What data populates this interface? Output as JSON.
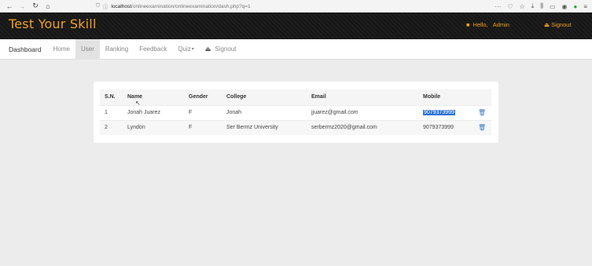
{
  "browser": {
    "url_prefix": "localhost",
    "url_rest": "/onlineexamination/onlineexamination/dash.php?q=1"
  },
  "header": {
    "brand": "Test Your Skill",
    "greeting": "Hello,",
    "user": "Admin",
    "signout": "Signout"
  },
  "nav": {
    "title": "Dashboard",
    "items": [
      "Home",
      "User",
      "Ranking",
      "Feedback",
      "Quiz"
    ],
    "active": "User",
    "signout": "Signout"
  },
  "table": {
    "headers": [
      "S.N.",
      "Name",
      "Gender",
      "College",
      "Email",
      "Mobile"
    ],
    "rows": [
      {
        "sn": "1",
        "name": "Jonah Juarez",
        "gender": "F",
        "college": "Jonah",
        "email": "jjuarez@gmail.com",
        "mobile": "9079373999",
        "mobile_selected": true
      },
      {
        "sn": "2",
        "name": "Lyndon",
        "gender": "F",
        "college": "Ser Bermz University",
        "email": "serbermz2020@gmail.com",
        "mobile": "9079373999",
        "mobile_selected": false
      }
    ]
  },
  "colors": {
    "accent": "#f2a01d",
    "header_bg": "#1a1a1a",
    "selection": "#2a72d6",
    "trash": "#3a79c6"
  }
}
